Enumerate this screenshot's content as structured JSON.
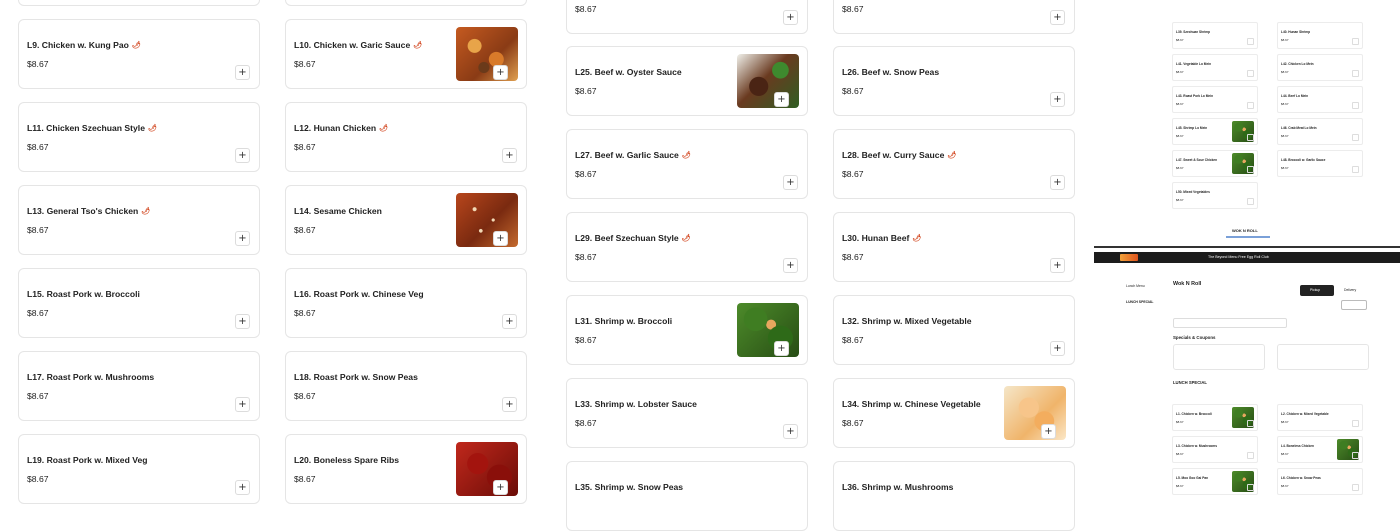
{
  "menu": {
    "currency_price": "$8.67",
    "add_symbol": "+",
    "chili_symbol": "🌶",
    "items": [
      {
        "id": "top1",
        "name": "",
        "price": "$8.67",
        "spicy": false
      },
      {
        "id": "top2",
        "name": "",
        "price": "$8.67",
        "spicy": false
      },
      {
        "id": "L9",
        "name": "L9. Chicken w. Kung Pao",
        "price": "$8.67",
        "spicy": true
      },
      {
        "id": "L10",
        "name": "L10. Chicken w. Garic Sauce",
        "price": "$8.67",
        "spicy": true
      },
      {
        "id": "L11",
        "name": "L11. Chicken Szechuan Style",
        "price": "$8.67",
        "spicy": true
      },
      {
        "id": "L12",
        "name": "L12. Hunan Chicken",
        "price": "$8.67",
        "spicy": true
      },
      {
        "id": "L13",
        "name": "L13. General Tso's Chicken",
        "price": "$8.67",
        "spicy": true
      },
      {
        "id": "L14",
        "name": "L14. Sesame Chicken",
        "price": "$8.67",
        "spicy": false
      },
      {
        "id": "L15",
        "name": "L15. Roast Pork w. Broccoli",
        "price": "$8.67",
        "spicy": false
      },
      {
        "id": "L16",
        "name": "L16. Roast Pork w. Chinese Veg",
        "price": "$8.67",
        "spicy": false
      },
      {
        "id": "L17",
        "name": "L17. Roast Pork w. Mushrooms",
        "price": "$8.67",
        "spicy": false
      },
      {
        "id": "L18",
        "name": "L18. Roast Pork w. Snow Peas",
        "price": "$8.67",
        "spicy": false
      },
      {
        "id": "L19",
        "name": "L19. Roast Pork w. Mixed Veg",
        "price": "$8.67",
        "spicy": false
      },
      {
        "id": "L20",
        "name": "L20. Boneless Spare Ribs",
        "price": "$8.67",
        "spicy": false
      },
      {
        "id": "L25",
        "name": "L25. Beef w. Oyster Sauce",
        "price": "$8.67",
        "spicy": false
      },
      {
        "id": "L26",
        "name": "L26. Beef w. Snow Peas",
        "price": "$8.67",
        "spicy": false
      },
      {
        "id": "L27",
        "name": "L27. Beef w. Garlic Sauce",
        "price": "$8.67",
        "spicy": true
      },
      {
        "id": "L28",
        "name": "L28. Beef w. Curry Sauce",
        "price": "$8.67",
        "spicy": true
      },
      {
        "id": "L29",
        "name": "L29. Beef Szechuan Style",
        "price": "$8.67",
        "spicy": true
      },
      {
        "id": "L30",
        "name": "L30. Hunan Beef",
        "price": "$8.67",
        "spicy": true
      },
      {
        "id": "L31",
        "name": "L31. Shrimp w. Broccoli",
        "price": "$8.67",
        "spicy": false
      },
      {
        "id": "L32",
        "name": "L32. Shrimp w. Mixed Vegetable",
        "price": "$8.67",
        "spicy": false
      },
      {
        "id": "L33",
        "name": "L33. Shrimp w. Lobster Sauce",
        "price": "$8.67",
        "spicy": false
      },
      {
        "id": "L34",
        "name": "L34. Shrimp w. Chinese Vegetable",
        "price": "$8.67",
        "spicy": false
      },
      {
        "id": "L35",
        "name": "L35. Shrimp w. Snow Peas",
        "price": "",
        "spicy": false
      },
      {
        "id": "L36",
        "name": "L36. Shrimp w. Mushrooms",
        "price": "",
        "spicy": false
      }
    ]
  },
  "preview": {
    "banner_text": "The Beyond Menu Free Egg Roll Club",
    "restaurant_name": "Wok N Roll",
    "footer_name": "WOK N ROLL",
    "section_specials": "Specials & Coupons",
    "section_lunch": "LUNCH SPECIAL",
    "pickup_label": "Pickup",
    "delivery_label": "Delivery",
    "nav_items": [
      "Lunch Menu",
      "LUNCH SPECIAL"
    ],
    "mini_items": [
      "L1. Chicken w. Broccoli",
      "L2. Chicken w. Mixed Vegetable",
      "L3. Chicken w. Mushrooms",
      "L4. Boneless Chicken",
      "L5. Moo Goo Gai Pan",
      "L6. Chicken w. Snow Peas",
      "L39. Szechuan Shrimp",
      "L40. Hunan Shrimp",
      "L41. Vegetable Lo Mein",
      "L42. Chicken Lo Mein",
      "L43. Roast Pork Lo Mein",
      "L44. Beef Lo Mein",
      "L45. Shrimp Lo Mein",
      "L46. Crab Meat Lo Mein",
      "L47. Sweet & Sour Chicken",
      "L48. Broccoli w. Garlic Sauce",
      "L50. Mixed Vegetables"
    ]
  }
}
